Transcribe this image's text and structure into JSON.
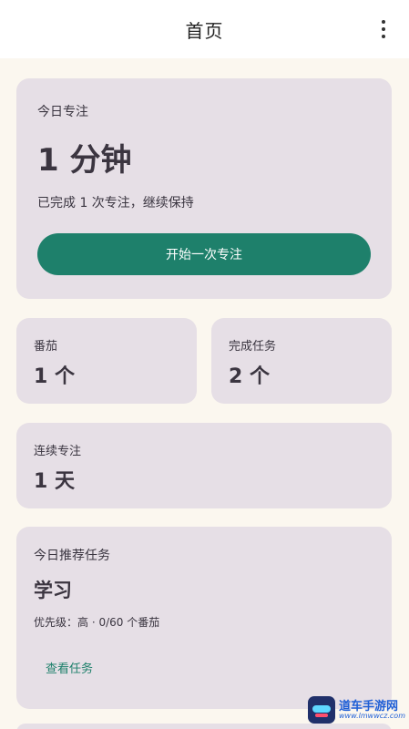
{
  "appbar": {
    "title": "首页",
    "menu_icon": "more-vert-icon"
  },
  "focus_card": {
    "label": "今日专注",
    "value": "1 分钟",
    "subtitle": "已完成 1 次专注，继续保持",
    "start_button": "开始一次专注"
  },
  "stats": {
    "tomatoes": {
      "label": "番茄",
      "value": "1 个"
    },
    "tasks_done": {
      "label": "完成任务",
      "value": "2 个"
    },
    "streak": {
      "label": "连续专注",
      "value": "1 天"
    }
  },
  "recommended": {
    "label": "今日推荐任务",
    "task_name": "学习",
    "meta": "优先级：高 · 0/60 个番茄",
    "view_link": "查看任务"
  },
  "watermark": {
    "name": "道车手游网",
    "url": "www.lmwwcz.com"
  },
  "colors": {
    "accent": "#1e806b",
    "card": "#e6dfe6",
    "background": "#fbf7ef"
  }
}
